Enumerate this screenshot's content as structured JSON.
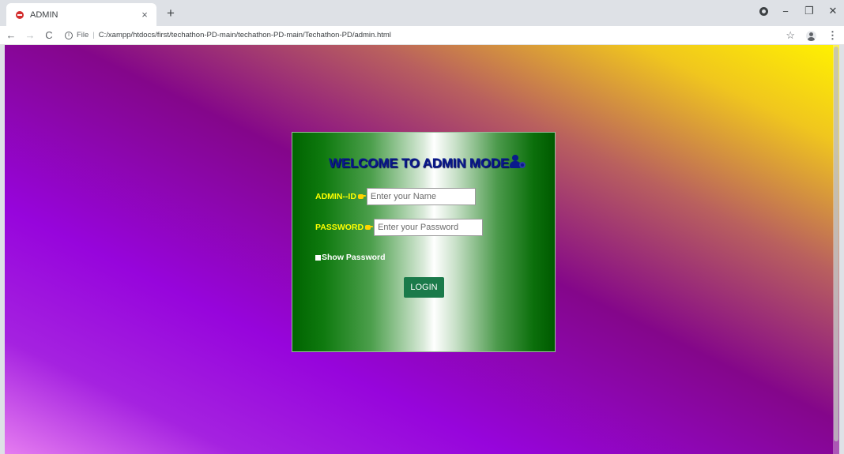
{
  "browser": {
    "tab": {
      "title": "ADMIN",
      "close_glyph": "×",
      "favicon": "stop-icon"
    },
    "new_tab_glyph": "+",
    "window_controls": {
      "minimize": "−",
      "maximize": "❐",
      "close": "✕"
    },
    "toolbar": {
      "back": "←",
      "forward": "→",
      "reload": "C",
      "scheme_label": "File",
      "separator": "|",
      "url": "C:/xampp/htdocs/first/techathon-PD-main/techathon-PD-main/Techathon-PD/admin.html",
      "bookmark_glyph": "☆",
      "menu_glyph": "⋮"
    }
  },
  "page": {
    "title": "WELCOME TO ADMIN MODE",
    "admin_id": {
      "label": "ADMIN--ID",
      "placeholder": "Enter your Name",
      "value": ""
    },
    "password": {
      "label": "PASSWORD",
      "placeholder": "Enter your Password",
      "value": ""
    },
    "show_password": {
      "label": "Show Password",
      "checked": false
    },
    "login_label": "LOGIN"
  },
  "colors": {
    "title_text": "#0a1a8c",
    "label_text": "#ffff00",
    "login_button": "#1a7a4a",
    "card_edge_green": "#006400"
  }
}
